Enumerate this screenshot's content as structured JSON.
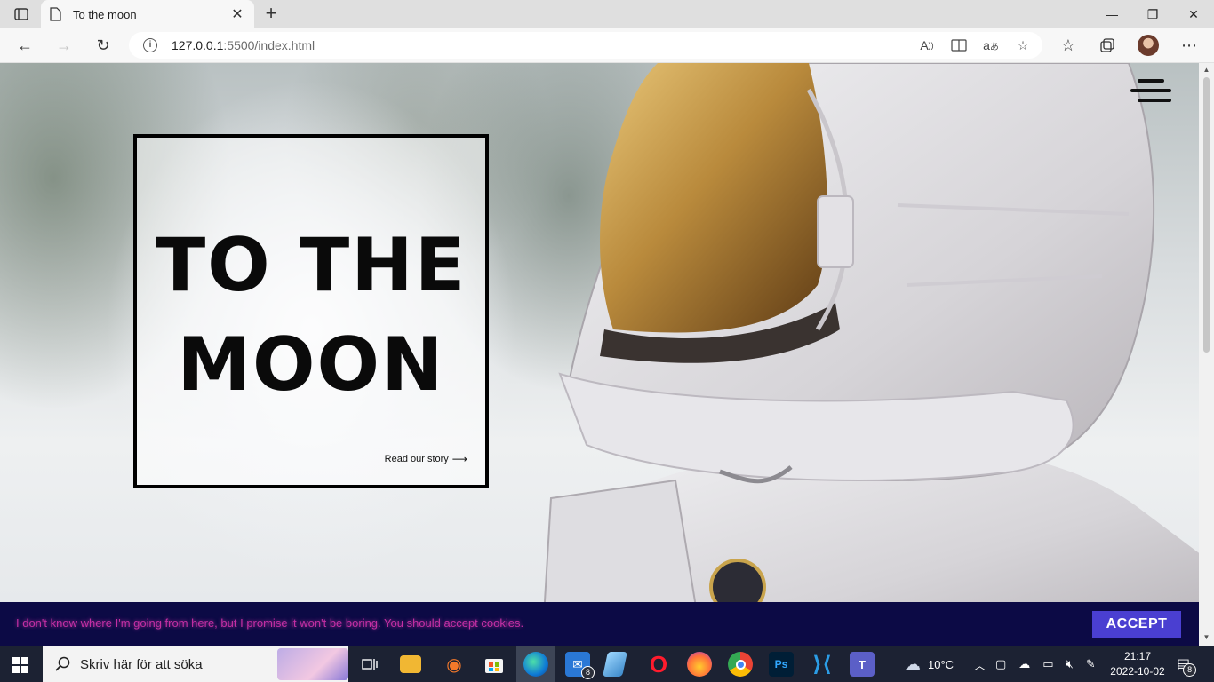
{
  "browser": {
    "tab_title": "To the moon",
    "tab_close": "✕",
    "new_tab": "+",
    "url_host": "127.0.0.1",
    "url_rest": ":5500/index.html",
    "window": {
      "minimize": "—",
      "maximize": "❐",
      "close": "✕"
    },
    "nav": {
      "back": "←",
      "forward": "→",
      "refresh": "↻"
    },
    "address_icons": [
      "read-aloud-icon",
      "immersive-reader-icon",
      "translate-icon",
      "add-favorite-icon"
    ],
    "toolbar_icons": [
      "favorites-icon",
      "collections-icon",
      "profile-avatar",
      "more-icon"
    ]
  },
  "page": {
    "hero_title_line1": "TO THE",
    "hero_title_line2": "MOON",
    "hero_link": "Read our story",
    "hero_link_arrow": "⟶",
    "cookie_text": "I don't know where I'm going from here, but I promise it won't be boring. You should accept cookies.",
    "cookie_button": "ACCEPT"
  },
  "taskbar": {
    "search_placeholder": "Skriv här för att söka",
    "mail_badge": "8",
    "weather": "10°C",
    "time": "21:17",
    "date": "2022-10-02",
    "notification_count": "8",
    "apps": [
      "task-view",
      "file-explorer",
      "blender",
      "microsoft-store",
      "edge",
      "mail",
      "notepad",
      "opera",
      "firefox",
      "chrome",
      "photoshop",
      "vscode",
      "teams"
    ]
  },
  "colors": {
    "cookie_bg": "#0c0a45",
    "cookie_text": "#c42fa4",
    "accept_button": "#4a3fd1",
    "taskbar": "#1c2233"
  }
}
